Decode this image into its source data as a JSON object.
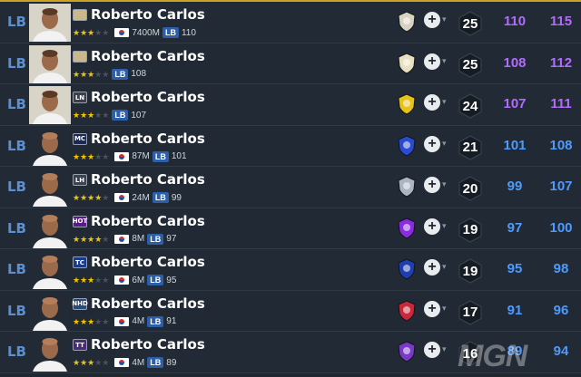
{
  "players": [
    {
      "position": "LB",
      "season": "",
      "season_color": "#c8b88a",
      "name": "Roberto Carlos",
      "stars": 3,
      "flag": true,
      "salary": "7400M",
      "lb_badge": "LB",
      "lb_value": "110",
      "club": "club-icon",
      "club_color": "#d8d2c0",
      "upgrade": "25",
      "ovr1": "110",
      "ovr2": "115",
      "ovr_color": "#b36bff"
    },
    {
      "position": "LB",
      "season": "",
      "season_color": "#c8b88a",
      "name": "Roberto Carlos",
      "stars": 3,
      "flag": false,
      "salary": "",
      "lb_badge": "LB",
      "lb_value": "108",
      "club": "real-madrid-crest-icon",
      "club_color": "#e8e0c0",
      "upgrade": "25",
      "ovr1": "108",
      "ovr2": "112",
      "ovr_color": "#b36bff"
    },
    {
      "position": "LB",
      "season": "LN",
      "season_color": "#3b3f4a",
      "name": "Roberto Carlos",
      "stars": 3,
      "flag": false,
      "salary": "",
      "lb_badge": "LB",
      "lb_value": "107",
      "club": "shield-crest-icon",
      "club_color": "#e6c21a",
      "upgrade": "24",
      "ovr1": "107",
      "ovr2": "111",
      "ovr_color": "#b36bff"
    },
    {
      "position": "LB",
      "season": "MC",
      "season_color": "#1b2a55",
      "name": "Roberto Carlos",
      "stars": 3,
      "flag": true,
      "salary": "87M",
      "lb_badge": "LB",
      "lb_value": "101",
      "club": "torch-crest-icon",
      "club_color": "#2a4bd0",
      "upgrade": "21",
      "ovr1": "101",
      "ovr2": "108",
      "ovr_color": "#4d9bff"
    },
    {
      "position": "LB",
      "season": "LH",
      "season_color": "#3a4254",
      "name": "Roberto Carlos",
      "stars": 4,
      "flag": true,
      "salary": "24M",
      "lb_badge": "LB",
      "lb_value": "99",
      "club": "diamond-crest-icon",
      "club_color": "#aab4c2",
      "upgrade": "20",
      "ovr1": "99",
      "ovr2": "107",
      "ovr_color": "#4d9bff"
    },
    {
      "position": "LB",
      "season": "HOT",
      "season_color": "#5a1a8a",
      "name": "Roberto Carlos",
      "stars": 4,
      "flag": true,
      "salary": "8M",
      "lb_badge": "LB",
      "lb_value": "97",
      "club": "purple-crest-icon",
      "club_color": "#8a2be2",
      "upgrade": "19",
      "ovr1": "97",
      "ovr2": "100",
      "ovr_color": "#4d9bff"
    },
    {
      "position": "LB",
      "season": "TC",
      "season_color": "#1a3a8a",
      "name": "Roberto Carlos",
      "stars": 3,
      "flag": true,
      "salary": "6M",
      "lb_badge": "LB",
      "lb_value": "95",
      "club": "round-crest-icon",
      "club_color": "#1f3fb0",
      "upgrade": "19",
      "ovr1": "95",
      "ovr2": "98",
      "ovr_color": "#4d9bff"
    },
    {
      "position": "LB",
      "season": "NHD",
      "season_color": "#2a4a7a",
      "name": "Roberto Carlos",
      "stars": 3,
      "flag": true,
      "salary": "4M",
      "lb_badge": "LB",
      "lb_value": "91",
      "club": "red-blue-crest-icon",
      "club_color": "#c8283a",
      "upgrade": "17",
      "ovr1": "91",
      "ovr2": "96",
      "ovr_color": "#4d9bff"
    },
    {
      "position": "LB",
      "season": "TT",
      "season_color": "#4a2a7a",
      "name": "Roberto Carlos",
      "stars": 3,
      "flag": true,
      "salary": "4M",
      "lb_badge": "LB",
      "lb_value": "89",
      "club": "purple-shield-crest-icon",
      "club_color": "#7a3ac8",
      "upgrade": "16",
      "ovr1": "89",
      "ovr2": "94",
      "ovr_color": "#4d9bff"
    }
  ],
  "watermark": "MGN"
}
